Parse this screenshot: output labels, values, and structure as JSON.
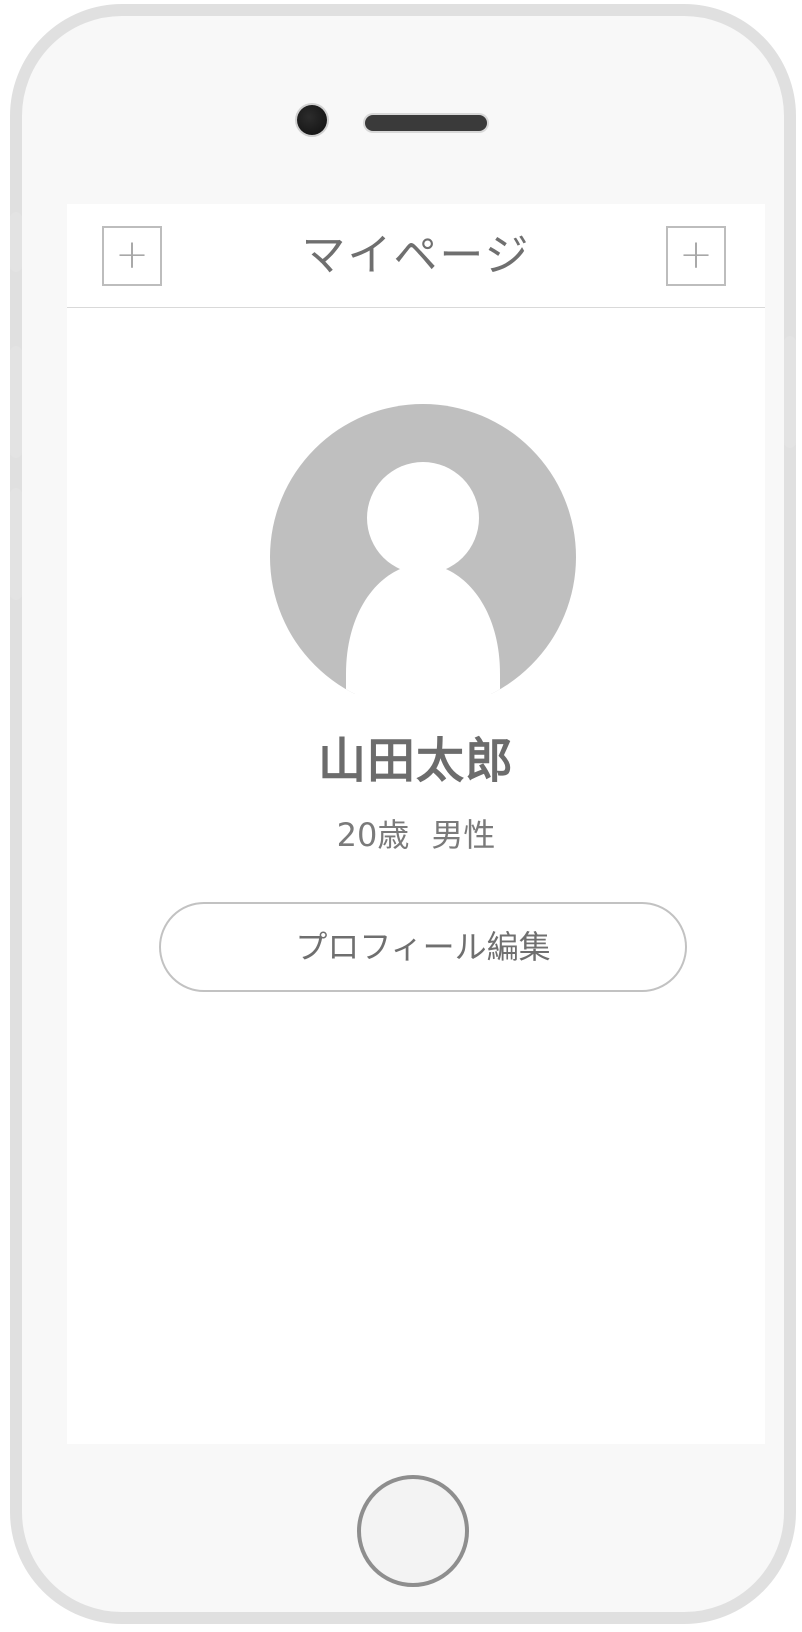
{
  "navbar": {
    "title": "マイページ",
    "left_button_icon": "plus-icon",
    "left_button_label": "+",
    "right_button_icon": "plus-icon",
    "right_button_label": "+"
  },
  "profile": {
    "avatar_icon": "user-silhouette-icon",
    "name": "山田太郎",
    "age": "20歳",
    "gender": "男性",
    "edit_button_label": "プロフィール編集"
  },
  "colors": {
    "device_frame": "#e0e0e0",
    "device_body": "#f8f8f8",
    "screen": "#ffffff",
    "text": "#6f6f6f",
    "avatar_bg": "#bfbfbf",
    "border": "#c2c2c2"
  }
}
